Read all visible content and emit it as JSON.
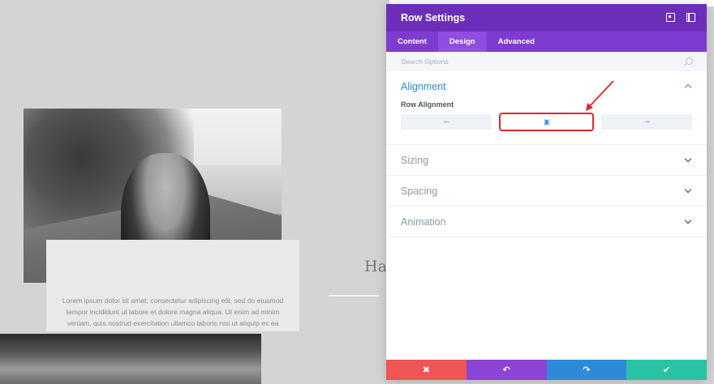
{
  "background": {
    "card_text": "Lorem ipsum dolor sit amet, consectetur adipiscing elit, sed do eiusmod tempor incididunt ut labore et dolore magna aliqua. Ut enim ad minim veniam, quis nostrud exercitation ullamco laboris nisi ut aliquip ex ea",
    "heading_partial": "Ha"
  },
  "panel": {
    "title": "Row Settings",
    "icons": [
      "expand-icon",
      "dock-sidebar-icon"
    ],
    "tabs": [
      {
        "label": "Content",
        "active": false
      },
      {
        "label": "Design",
        "active": true
      },
      {
        "label": "Advanced",
        "active": false
      }
    ],
    "search": {
      "placeholder": "Search Options"
    },
    "sections": {
      "alignment": {
        "title": "Alignment",
        "open": true,
        "field_label": "Row Alignment",
        "options": [
          {
            "name": "left",
            "glyph": "⇤",
            "selected": false
          },
          {
            "name": "center",
            "glyph": "|▮|",
            "selected": true
          },
          {
            "name": "right",
            "glyph": "⇥",
            "selected": false
          }
        ]
      },
      "sizing": {
        "title": "Sizing",
        "open": false
      },
      "spacing": {
        "title": "Spacing",
        "open": false
      },
      "animation": {
        "title": "Animation",
        "open": false
      }
    },
    "footer": {
      "cancel": {
        "glyph": "✖",
        "color": "#ef5555"
      },
      "undo": {
        "glyph": "↶",
        "color": "#8b44d6"
      },
      "redo": {
        "glyph": "↷",
        "color": "#2d8ad8"
      },
      "save": {
        "glyph": "✔",
        "color": "#29c3a4"
      }
    }
  },
  "colors": {
    "header": "#6c2eb9",
    "tabs": "#7e3bd0",
    "accent_blue": "#2e8bd8",
    "annotation_red": "#e0262a"
  }
}
